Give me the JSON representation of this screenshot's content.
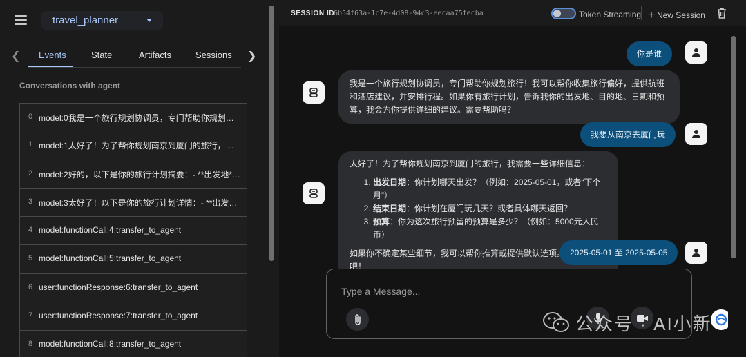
{
  "sidebar": {
    "app_name": "travel_planner",
    "tabs": [
      {
        "label": "Events",
        "active": true
      },
      {
        "label": "State",
        "active": false
      },
      {
        "label": "Artifacts",
        "active": false
      },
      {
        "label": "Sessions",
        "active": false
      }
    ],
    "heading": "Conversations with agent",
    "events": [
      {
        "index": "0",
        "text": "model:0我是一个旅行规划协调员，专门帮助你规划旅行…"
      },
      {
        "index": "1",
        "text": "model:1太好了！为了帮你规划南京到厦门的旅行，我需…"
      },
      {
        "index": "2",
        "text": "model:2好的，以下是你的旅行计划摘要：- **出发地**…"
      },
      {
        "index": "3",
        "text": "model:3太好了！以下是你的旅行计划详情：- **出发地…"
      },
      {
        "index": "4",
        "text": "model:functionCall:4:transfer_to_agent"
      },
      {
        "index": "5",
        "text": "model:functionCall:5:transfer_to_agent"
      },
      {
        "index": "6",
        "text": "user:functionResponse:6:transfer_to_agent"
      },
      {
        "index": "7",
        "text": "user:functionResponse:7:transfer_to_agent"
      },
      {
        "index": "8",
        "text": "model:functionCall:8:transfer_to_agent"
      }
    ]
  },
  "header": {
    "session_label": "SESSION ID",
    "session_id": "6b54f63a-1c7e-4d08-94c3-eecaa75fecba",
    "streaming_label": "Token Streaming",
    "streaming_enabled": false,
    "new_session_label": "New Session"
  },
  "chat": {
    "messages": [
      {
        "role": "user",
        "text": "你是谁"
      },
      {
        "role": "agent",
        "text": "我是一个旅行规划协调员，专门帮助你规划旅行！我可以帮你收集旅行偏好，提供航班和酒店建议，并安排行程。如果你有旅行计划，告诉我你的出发地、目的地、日期和预算，我会为你提供详细的建议。需要帮助吗？"
      },
      {
        "role": "user",
        "text": "我想从南京去厦门玩"
      },
      {
        "role": "agent",
        "intro": "太好了！为了帮你规划南京到厦门的旅行，我需要一些详细信息：",
        "items": [
          {
            "bold": "出发日期",
            "rest": "：你计划哪天出发？（例如：2025-05-01，或者“下个月”）"
          },
          {
            "bold": "结束日期",
            "rest": "：你计划在厦门玩几天？或者具体哪天返回？"
          },
          {
            "bold": "预算",
            "rest": "：你为这次旅行预留的预算是多少？（例如：5000元人民币）"
          }
        ],
        "outro": "如果你不确定某些细节，我可以帮你推算或提供默认选项。请告诉我吧！"
      },
      {
        "role": "user",
        "text": "2025-05-01 至 2025-05-05"
      }
    ]
  },
  "composer": {
    "placeholder": "Type a Message..."
  },
  "watermark": {
    "text": "公众号 · AI小新"
  },
  "colors": {
    "accent": "#a8c7fa",
    "user_bubble": "#0b4f7a",
    "agent_bubble": "#2c2d30"
  }
}
